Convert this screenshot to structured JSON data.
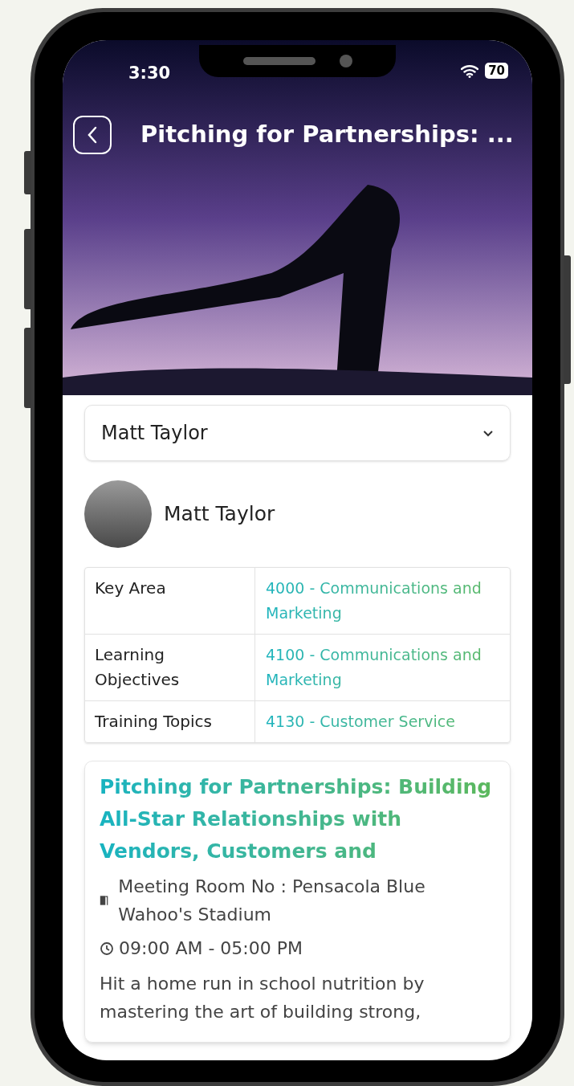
{
  "status_bar": {
    "time": "3:30",
    "battery": "70"
  },
  "header": {
    "title": "Pitching for Partnerships: ..."
  },
  "speaker_select": {
    "value": "Matt Taylor"
  },
  "speaker": {
    "name": "Matt Taylor"
  },
  "details": [
    {
      "label": "Key Area",
      "value": "4000 - Communications and Marketing"
    },
    {
      "label": "Learning Objectives",
      "value": "4100 - Communications and Marketing"
    },
    {
      "label": "Training Topics",
      "value": "4130 - Customer Service"
    }
  ],
  "session": {
    "title": "Pitching for Partnerships: Building All-Star Relationships with Vendors, Customers and",
    "room": "Meeting Room No : Pensacola Blue Wahoo's Stadium",
    "time": "09:00 AM - 05:00 PM",
    "description": "Hit a home run in school nutrition by mastering the art of building strong,"
  }
}
